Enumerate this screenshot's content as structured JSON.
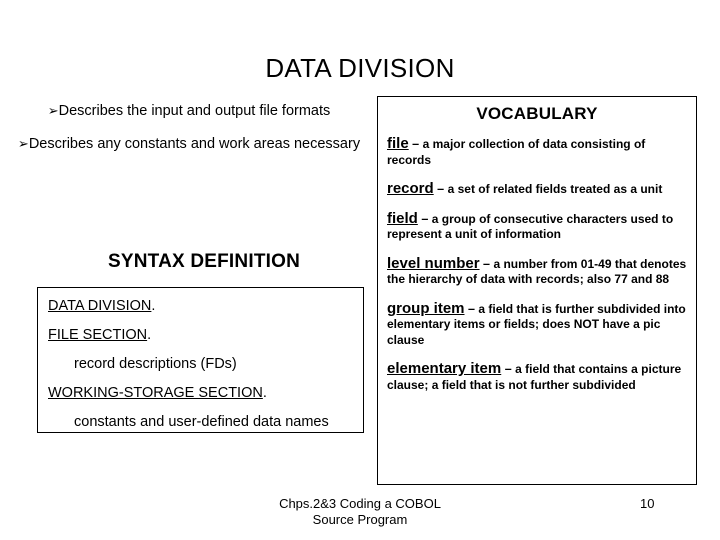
{
  "slide": {
    "title": "DATA DIVISION",
    "page_number": "10",
    "footer_line1": "Chps.2&3 Coding a COBOL",
    "footer_line2": "Source Program"
  },
  "left_column": {
    "bullet_glyph": "➢",
    "bullets": [
      "Describes the input and output file formats",
      "Describes any constants and work areas necessary"
    ],
    "syntax_heading": "SYNTAX DEFINITION"
  },
  "syntax_box": {
    "lines": [
      {
        "keyword": "DATA DIVISION",
        "trailing": ".",
        "indented": false
      },
      {
        "keyword": "FILE SECTION",
        "trailing": ".",
        "indented": false
      },
      {
        "keyword": "",
        "trailing": "record descriptions (FDs)",
        "indented": true
      },
      {
        "keyword": "WORKING-STORAGE SECTION",
        "trailing": ".",
        "indented": false
      },
      {
        "keyword": "",
        "trailing": "constants and user-defined data names",
        "indented": true
      }
    ]
  },
  "vocabulary": {
    "heading": "VOCABULARY",
    "dash": "–",
    "entries": [
      {
        "term": "file",
        "definition": "a major collection of data consisting of records"
      },
      {
        "term": "record",
        "definition": "a set of related fields treated as a unit"
      },
      {
        "term": "field",
        "definition": "a group of consecutive characters used to represent a unit of information"
      },
      {
        "term": "level number",
        "definition": "a number from 01-49 that denotes the hierarchy of data with records; also 77 and 88"
      },
      {
        "term": "group item",
        "definition": "a field that is further subdivided into elementary items or fields; does NOT have a pic clause"
      },
      {
        "term": "elementary item",
        "definition": "a field that contains a picture clause; a field that is not further subdivided"
      }
    ]
  },
  "colors": {
    "background": "#ffffff",
    "text": "#000000",
    "border": "#000000"
  }
}
